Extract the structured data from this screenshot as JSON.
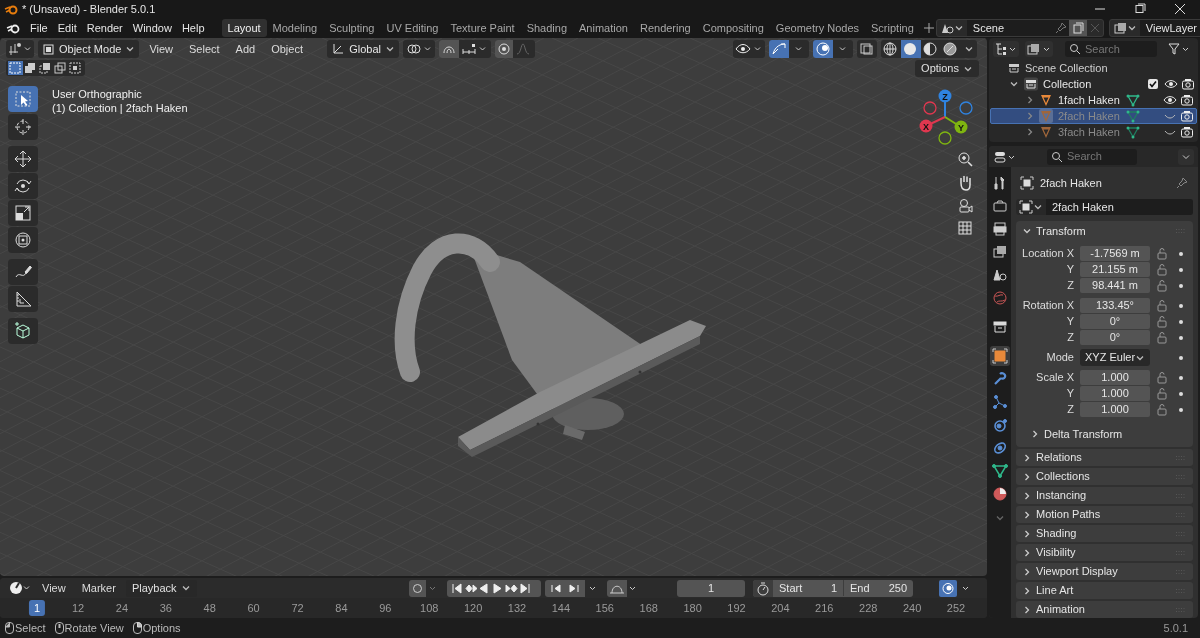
{
  "window": {
    "title": "* (Unsaved) - Blender 5.0.1"
  },
  "menu": [
    "File",
    "Edit",
    "Render",
    "Window",
    "Help"
  ],
  "workspaces": [
    {
      "label": "Layout",
      "selected": true
    },
    {
      "label": "Modeling",
      "selected": false
    },
    {
      "label": "Sculpting",
      "selected": false
    },
    {
      "label": "UV Editing",
      "selected": false
    },
    {
      "label": "Texture Paint",
      "selected": false
    },
    {
      "label": "Shading",
      "selected": false
    },
    {
      "label": "Animation",
      "selected": false
    },
    {
      "label": "Rendering",
      "selected": false
    },
    {
      "label": "Compositing",
      "selected": false
    },
    {
      "label": "Geometry Nodes",
      "selected": false
    },
    {
      "label": "Scripting",
      "selected": false
    }
  ],
  "scene": {
    "name": "Scene"
  },
  "view_layer": {
    "name": "ViewLayer"
  },
  "viewport": {
    "mode": "Object Mode",
    "menus": [
      "View",
      "Select",
      "Add",
      "Object"
    ],
    "orientation": "Global",
    "options": "Options",
    "view_name": "User Orthographic",
    "context": "(1) Collection | 2fach Haken",
    "select_modes": [
      {
        "selected": true
      },
      {
        "selected": false
      },
      {
        "selected": false
      },
      {
        "selected": false
      },
      {
        "selected": false
      }
    ],
    "shading_modes": [
      {
        "kind": "wireframe",
        "selected": false
      },
      {
        "kind": "solid",
        "selected": true
      },
      {
        "kind": "material",
        "selected": false
      },
      {
        "kind": "rendered",
        "selected": false
      }
    ],
    "tools": [
      {
        "kind": "select",
        "selected": true
      },
      {
        "kind": "cursor",
        "selected": false
      },
      {
        "kind": "move",
        "selected": false
      },
      {
        "kind": "rotate",
        "selected": false
      },
      {
        "kind": "scale",
        "selected": false
      },
      {
        "kind": "transform",
        "selected": false
      },
      {
        "kind": "annotate",
        "selected": false
      },
      {
        "kind": "measure",
        "selected": false
      },
      {
        "kind": "add_cube",
        "selected": false
      }
    ],
    "gizmo_axes": [
      {
        "label": "Z",
        "color": "#2f83e0"
      },
      {
        "label": "X",
        "color": "#e0374f"
      },
      {
        "label": "Y",
        "color": "#7fb510"
      }
    ]
  },
  "outliner": {
    "search_placeholder": "Search",
    "root": "Scene Collection",
    "collection": {
      "label": "Collection",
      "expanded": true,
      "checked": true,
      "children": [
        {
          "label": "1fach Haken",
          "selected": false,
          "visible": true
        },
        {
          "label": "2fach Haken",
          "selected": true,
          "visible": false
        },
        {
          "label": "3fach Haken",
          "selected": false,
          "visible": false
        }
      ]
    }
  },
  "properties": {
    "search_placeholder": "Search",
    "object_name": "2fach Haken",
    "data_name": "2fach Haken",
    "tabs": [
      {
        "kind": "tool",
        "selected": false
      },
      {
        "kind": "render",
        "selected": false
      },
      {
        "kind": "output",
        "selected": false
      },
      {
        "kind": "view_layer",
        "selected": false
      },
      {
        "kind": "scene",
        "selected": false
      },
      {
        "kind": "world",
        "selected": false
      },
      {
        "kind": "collection",
        "selected": false
      },
      {
        "kind": "object",
        "selected": true
      },
      {
        "kind": "modifiers",
        "selected": false
      },
      {
        "kind": "particles",
        "selected": false
      },
      {
        "kind": "physics",
        "selected": false
      },
      {
        "kind": "constraints",
        "selected": false
      },
      {
        "kind": "data",
        "selected": false
      },
      {
        "kind": "material",
        "selected": false
      }
    ],
    "transform": {
      "title": "Transform",
      "expanded": true,
      "groups": [
        {
          "rows": [
            {
              "label": "Location X",
              "value": "-1.7569 m",
              "kind": "number"
            },
            {
              "label": "Y",
              "value": "21.155 m",
              "kind": "number"
            },
            {
              "label": "Z",
              "value": "98.441 m",
              "kind": "number"
            }
          ]
        },
        {
          "rows": [
            {
              "label": "Rotation X",
              "value": "133.45°",
              "kind": "number"
            },
            {
              "label": "Y",
              "value": "0°",
              "kind": "number"
            },
            {
              "label": "Z",
              "value": "0°",
              "kind": "number"
            }
          ]
        },
        {
          "rows": [
            {
              "label": "Mode",
              "value": "XYZ Euler",
              "kind": "enum"
            }
          ]
        },
        {
          "rows": [
            {
              "label": "Scale X",
              "value": "1.000",
              "kind": "number"
            },
            {
              "label": "Y",
              "value": "1.000",
              "kind": "number"
            },
            {
              "label": "Z",
              "value": "1.000",
              "kind": "number"
            }
          ]
        }
      ],
      "subpanels": [
        {
          "label": "Delta Transform",
          "expanded": false
        }
      ]
    },
    "panels": [
      {
        "label": "Relations",
        "expanded": false
      },
      {
        "label": "Collections",
        "expanded": false
      },
      {
        "label": "Instancing",
        "expanded": false
      },
      {
        "label": "Motion Paths",
        "expanded": false
      },
      {
        "label": "Shading",
        "expanded": false
      },
      {
        "label": "Visibility",
        "expanded": false
      },
      {
        "label": "Viewport Display",
        "expanded": false
      },
      {
        "label": "Line Art",
        "expanded": false
      },
      {
        "label": "Animation",
        "expanded": false
      }
    ]
  },
  "timeline": {
    "menus": [
      "View",
      "Marker"
    ],
    "playback": "Playback",
    "current_frame": "1",
    "start_label": "Start",
    "start": "1",
    "end_label": "End",
    "end": "250",
    "ticks": [
      {
        "label": "1",
        "selected": true
      },
      {
        "label": "12",
        "selected": false
      },
      {
        "label": "24",
        "selected": false
      },
      {
        "label": "36",
        "selected": false
      },
      {
        "label": "48",
        "selected": false
      },
      {
        "label": "60",
        "selected": false
      },
      {
        "label": "72",
        "selected": false
      },
      {
        "label": "84",
        "selected": false
      },
      {
        "label": "96",
        "selected": false
      },
      {
        "label": "108",
        "selected": false
      },
      {
        "label": "120",
        "selected": false
      },
      {
        "label": "132",
        "selected": false
      },
      {
        "label": "144",
        "selected": false
      },
      {
        "label": "156",
        "selected": false
      },
      {
        "label": "168",
        "selected": false
      },
      {
        "label": "180",
        "selected": false
      },
      {
        "label": "192",
        "selected": false
      },
      {
        "label": "204",
        "selected": false
      },
      {
        "label": "216",
        "selected": false
      },
      {
        "label": "228",
        "selected": false
      },
      {
        "label": "240",
        "selected": false
      },
      {
        "label": "252",
        "selected": false
      }
    ]
  },
  "status_bar": {
    "hints": [
      "Select",
      "Rotate View",
      "Options"
    ],
    "version": "5.0.1"
  }
}
